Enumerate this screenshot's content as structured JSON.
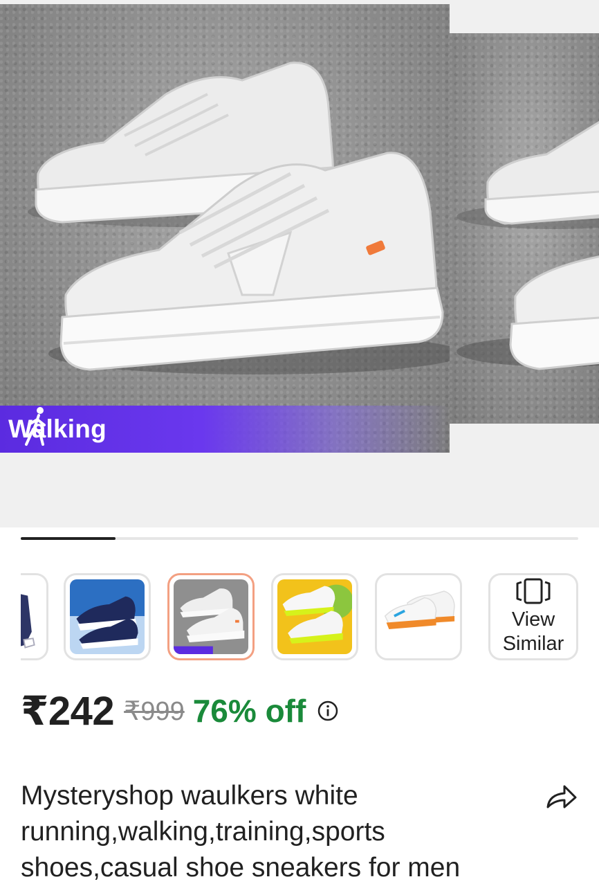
{
  "gallery": {
    "activity_label": "Walking",
    "activity_icon": "walking-person-icon",
    "slide_progress_percent": 17
  },
  "thumbnails": [
    {
      "name": "thumb-partial-navy-shoe",
      "selected": false
    },
    {
      "name": "thumb-navy-blue-sneakers",
      "selected": false
    },
    {
      "name": "thumb-white-sneakers",
      "selected": true
    },
    {
      "name": "thumb-white-neon-sneakers",
      "selected": false
    },
    {
      "name": "thumb-white-orange-sole-sneakers",
      "selected": false
    }
  ],
  "view_similar": {
    "line1": "View",
    "line2": "Similar",
    "icon": "view-similar-cards-icon"
  },
  "price": {
    "selling": "₹242",
    "mrp": "₹999",
    "discount": "76% off",
    "info_icon": "info-icon"
  },
  "product": {
    "title": "Mysteryshop waulkers white running,walking,training,sports shoes,casual shoe sneakers for men",
    "share_icon": "share-icon"
  },
  "colors": {
    "discount_green": "#1a8a3a",
    "banner_purple": "#5b2be0",
    "selected_border": "#f3a082"
  }
}
